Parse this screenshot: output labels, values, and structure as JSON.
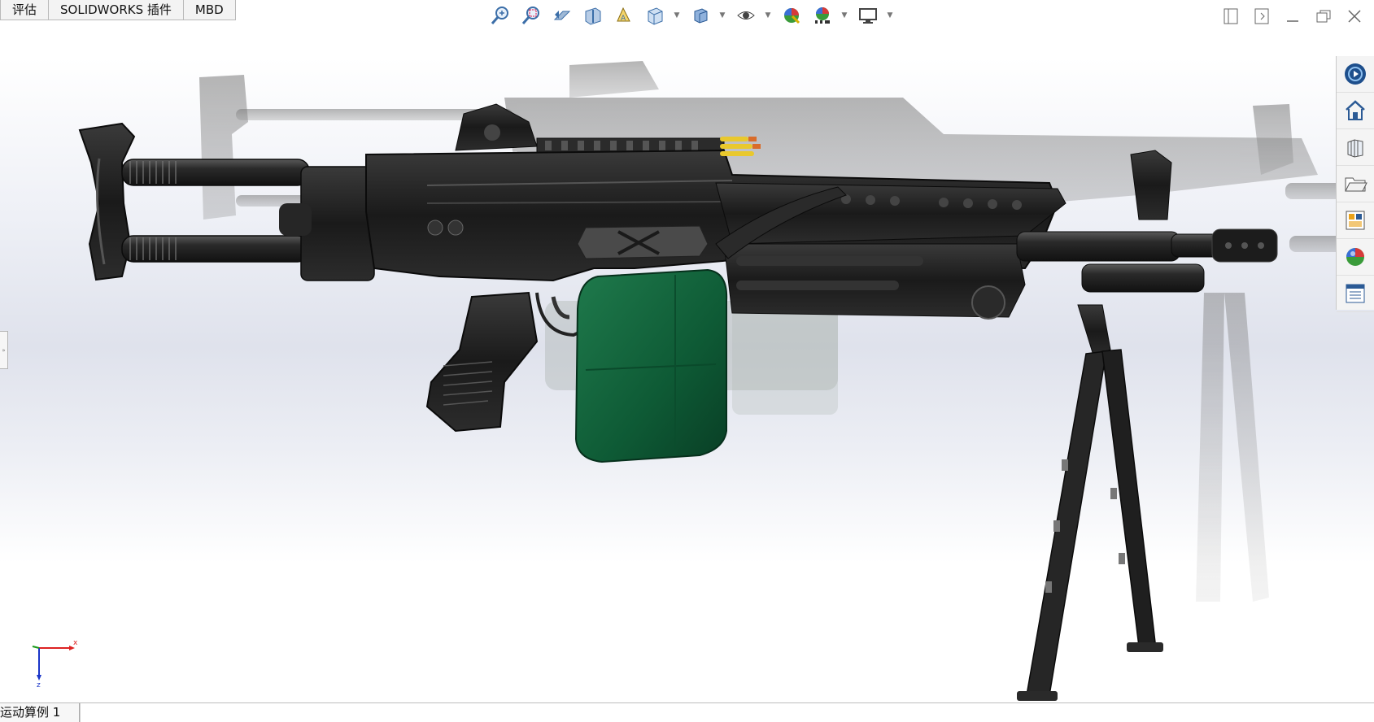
{
  "tabs": [
    {
      "label": "评估"
    },
    {
      "label": "SOLIDWORKS 插件"
    },
    {
      "label": "MBD"
    }
  ],
  "heads_up_toolbar": [
    {
      "icon": "zoom-to-fit-icon"
    },
    {
      "icon": "zoom-to-area-icon"
    },
    {
      "icon": "previous-view-icon"
    },
    {
      "icon": "section-view-icon"
    },
    {
      "icon": "dynamic-annotation-views-icon"
    },
    {
      "icon": "view-orientation-icon"
    },
    {
      "icon": "display-style-icon"
    },
    {
      "icon": "hide-show-items-icon"
    },
    {
      "icon": "edit-appearance-icon"
    },
    {
      "icon": "apply-scene-icon"
    },
    {
      "icon": "view-settings-icon"
    }
  ],
  "window_controls": [
    {
      "icon": "tile-left-icon"
    },
    {
      "icon": "tile-right-icon"
    },
    {
      "icon": "minimize-icon"
    },
    {
      "icon": "restore-icon"
    },
    {
      "icon": "close-icon"
    }
  ],
  "task_pane": [
    {
      "icon": "solidworks-resources-icon"
    },
    {
      "icon": "home-icon"
    },
    {
      "icon": "design-library-icon"
    },
    {
      "icon": "file-explorer-icon"
    },
    {
      "icon": "view-palette-icon"
    },
    {
      "icon": "appearances-scenes-icon"
    },
    {
      "icon": "custom-properties-icon"
    }
  ],
  "triad": {
    "x_label": "x",
    "z_label": "z"
  },
  "status_bar": {
    "tab_label": "运动算例 1"
  },
  "colors": {
    "magazine": "#0e5a35",
    "receiver": "#1c1c1c",
    "ammo": "#e9c82d"
  }
}
